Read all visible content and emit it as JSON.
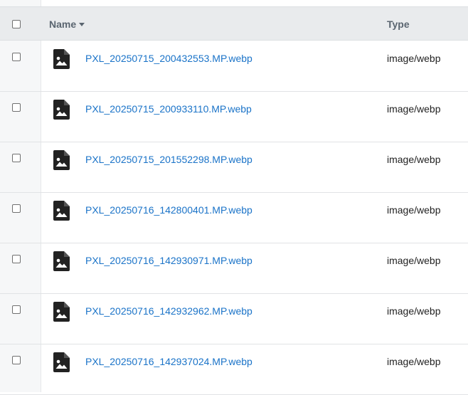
{
  "header": {
    "name_label": "Name",
    "type_label": "Type"
  },
  "files": [
    {
      "name": "PXL_20250715_200432553.MP.webp",
      "type": "image/webp"
    },
    {
      "name": "PXL_20250715_200933110.MP.webp",
      "type": "image/webp"
    },
    {
      "name": "PXL_20250715_201552298.MP.webp",
      "type": "image/webp"
    },
    {
      "name": "PXL_20250716_142800401.MP.webp",
      "type": "image/webp"
    },
    {
      "name": "PXL_20250716_142930971.MP.webp",
      "type": "image/webp"
    },
    {
      "name": "PXL_20250716_142932962.MP.webp",
      "type": "image/webp"
    },
    {
      "name": "PXL_20250716_142937024.MP.webp",
      "type": "image/webp"
    }
  ],
  "icons": {
    "file": "image-file-icon",
    "sort": "sort-descending-caret-icon"
  },
  "colors": {
    "link": "#1a73c8",
    "header_bg": "#e9ebed",
    "icon": "#222222"
  }
}
